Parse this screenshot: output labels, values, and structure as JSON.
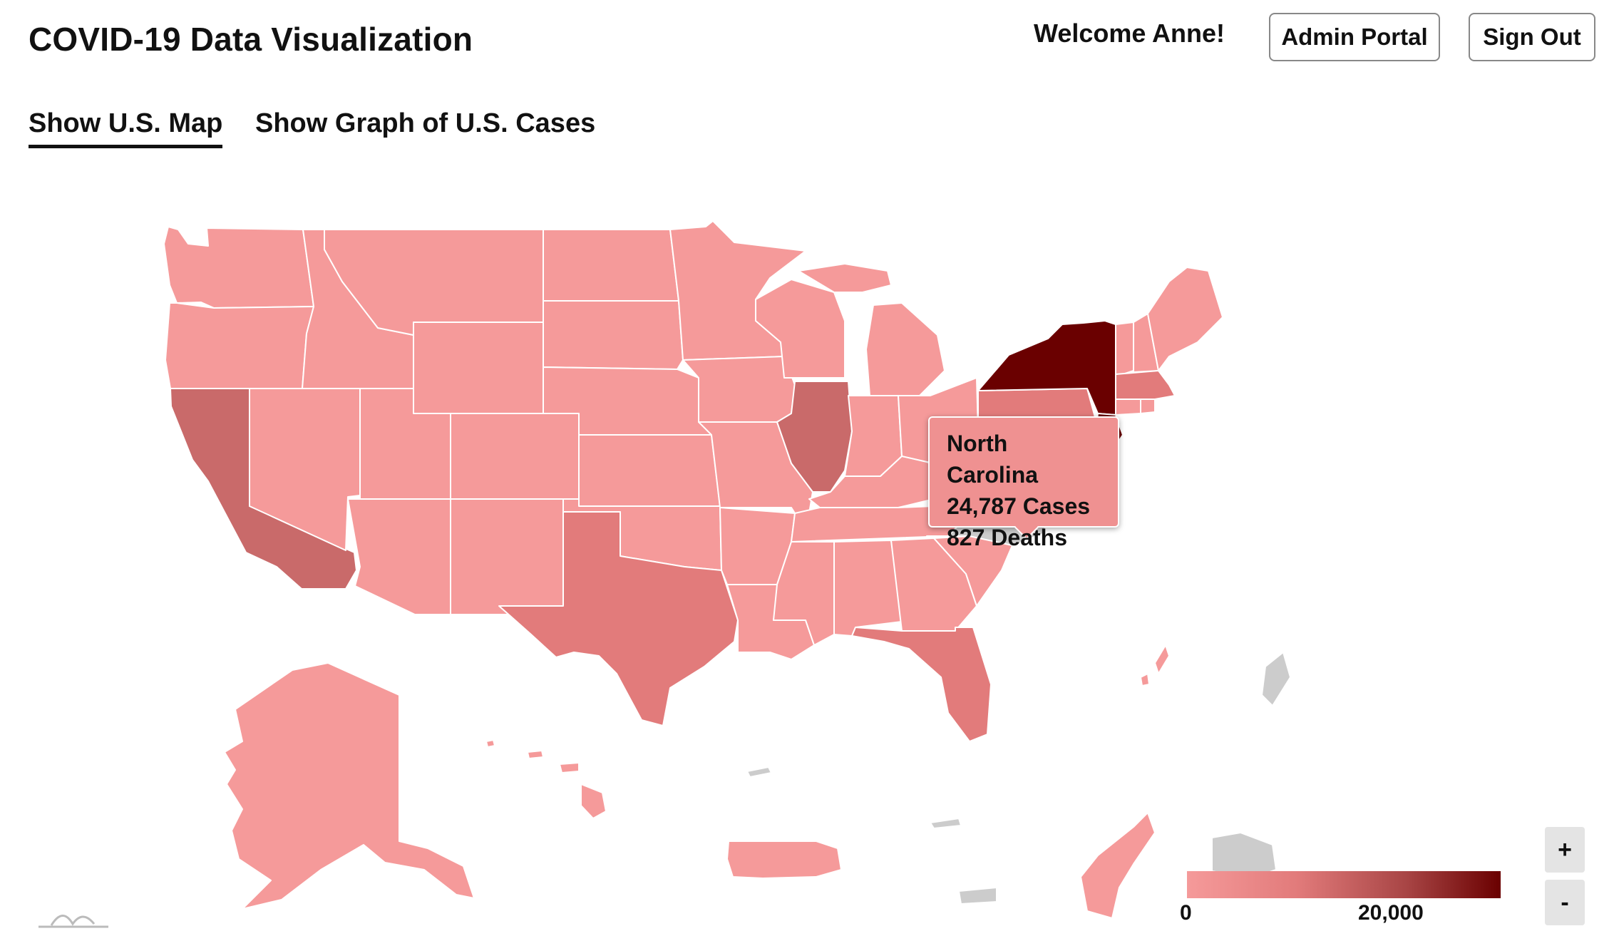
{
  "header": {
    "title": "COVID-19 Data Visualization",
    "welcome": "Welcome Anne!",
    "admin_label": "Admin Portal",
    "signout_label": "Sign Out"
  },
  "tabs": [
    {
      "label": "Show U.S. Map",
      "active": true
    },
    {
      "label": "Show Graph of U.S. Cases",
      "active": false
    }
  ],
  "map": {
    "colors": {
      "low": "#f59a9a",
      "mid": "#e27b7b",
      "high": "#c96a6a",
      "max": "#6a0000",
      "no_data": "#cccccc",
      "border": "#ffffff"
    },
    "tooltip": {
      "state": "North Carolina",
      "cases": "24,787 Cases",
      "deaths": "827 Deaths"
    },
    "legend": {
      "min_label": "0",
      "max_label": "20,000"
    },
    "zoom_in_label": "+",
    "zoom_out_label": "-"
  }
}
